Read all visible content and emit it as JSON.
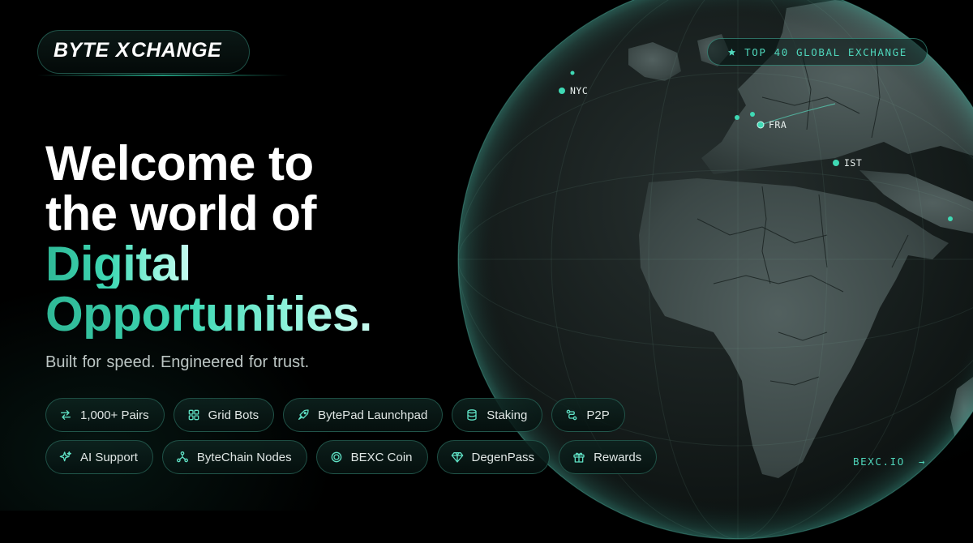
{
  "brand": {
    "logo_part1": "BYTE",
    "logo_x": "X",
    "logo_part2": "CHANGE"
  },
  "badge": {
    "icon": "star-icon",
    "text": "TOP 40 GLOBAL EXCHANGE"
  },
  "hero": {
    "line1": "Welcome to",
    "line2": "the world of",
    "line3": "Digital",
    "line4": "Opportunities."
  },
  "tagline": "Built for speed.  Engineered for trust.",
  "features_row1": [
    {
      "label": "1,000+ Pairs",
      "icon": "swap-arrows-icon"
    },
    {
      "label": "Grid Bots",
      "icon": "grid-icon"
    },
    {
      "label": "BytePad Launchpad",
      "icon": "rocket-icon"
    },
    {
      "label": "Staking",
      "icon": "database-icon"
    },
    {
      "label": "P2P",
      "icon": "route-icon"
    }
  ],
  "features_row2": [
    {
      "label": "AI Support",
      "icon": "sparkles-icon"
    },
    {
      "label": "ByteChain Nodes",
      "icon": "nodes-icon"
    },
    {
      "label": "BEXC Coin",
      "icon": "coin-icon"
    },
    {
      "label": "DegenPass",
      "icon": "gem-icon"
    },
    {
      "label": "Rewards",
      "icon": "gift-icon"
    }
  ],
  "globe": {
    "cities": [
      "NYC",
      "FRA",
      "IST"
    ]
  },
  "site_link": {
    "text": "BEXC.IO",
    "arrow": "→"
  },
  "colors": {
    "accent": "#3fd9b4",
    "accent_light": "#8ff3dc",
    "background": "#000000",
    "muted_text": "#bcc6c4"
  }
}
